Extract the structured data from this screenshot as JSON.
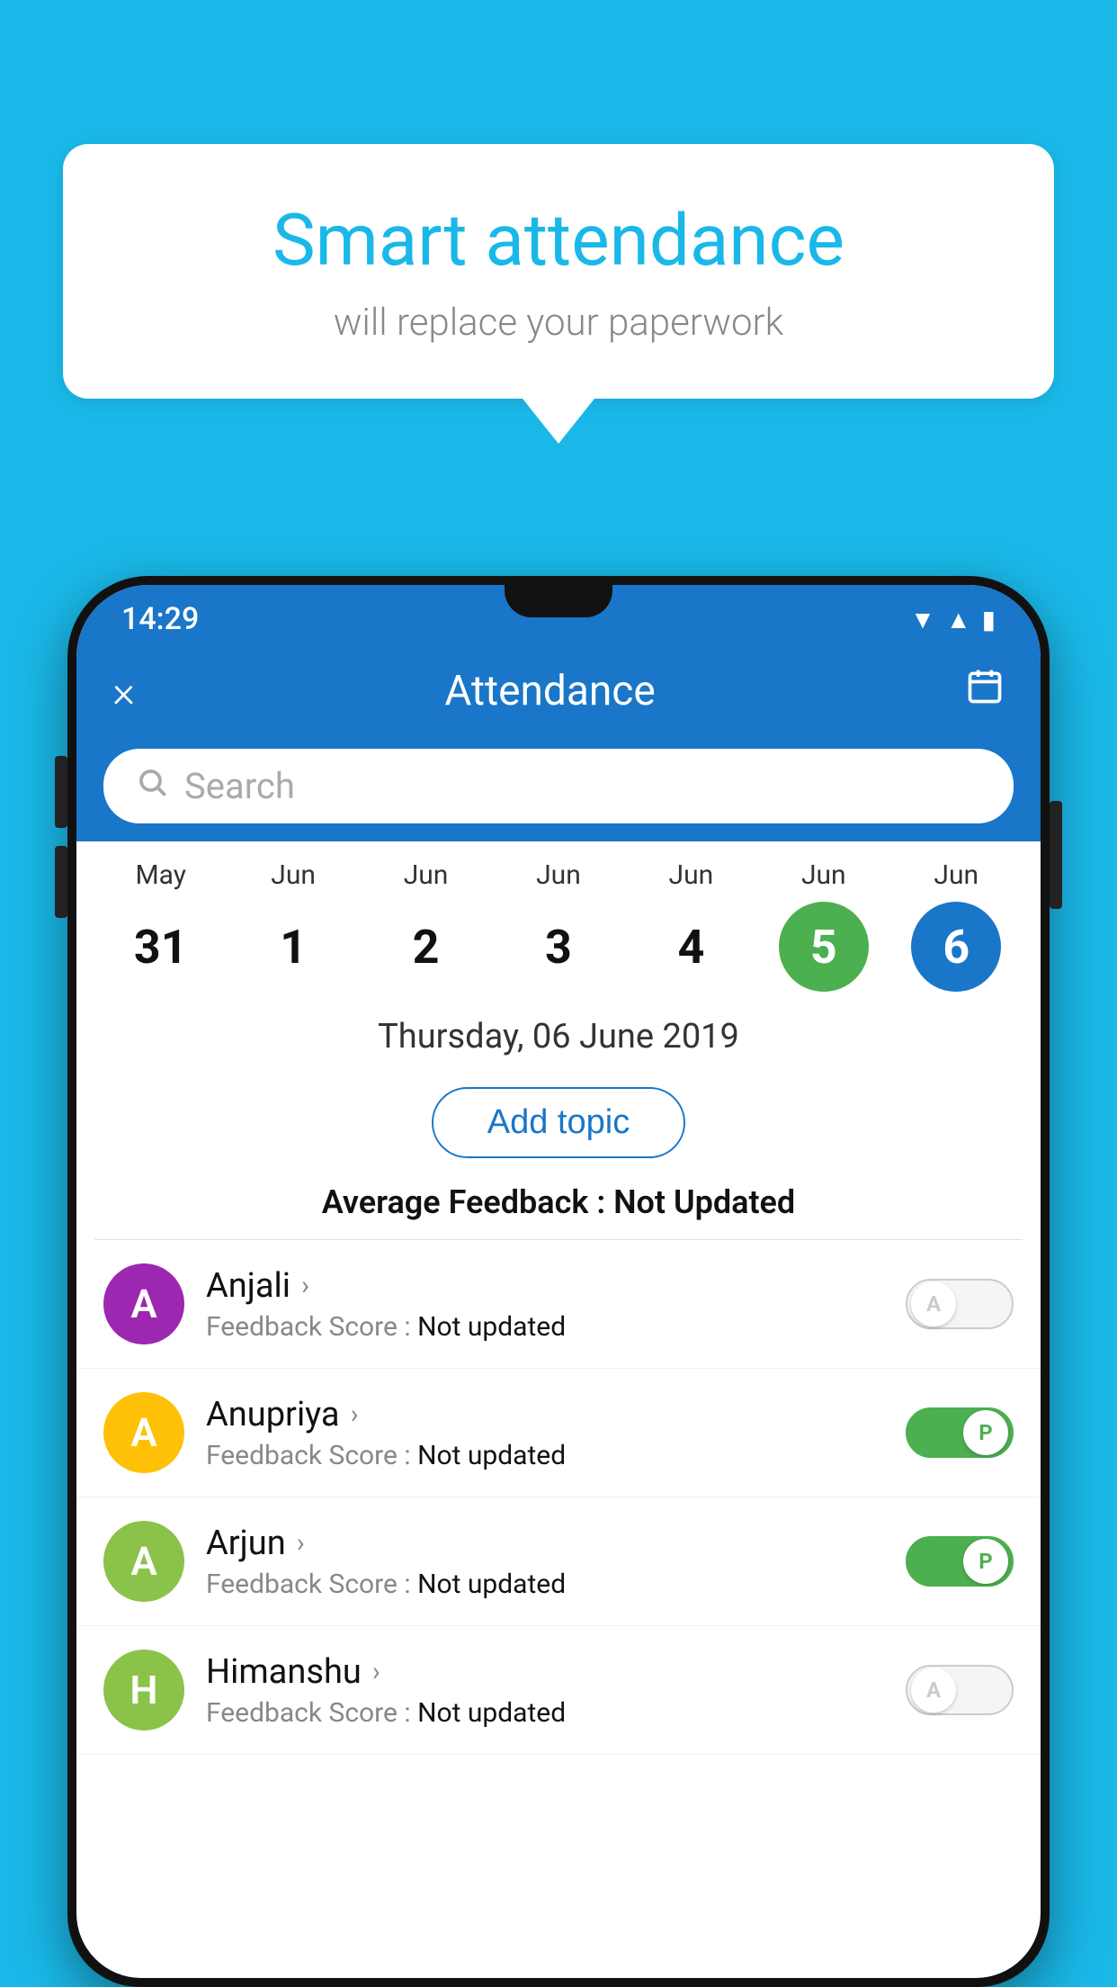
{
  "background_color": "#1ab8e8",
  "bubble": {
    "title": "Smart attendance",
    "subtitle": "will replace your paperwork"
  },
  "status_bar": {
    "time": "14:29"
  },
  "header": {
    "title": "Attendance",
    "close_label": "×",
    "calendar_icon": "calendar"
  },
  "search": {
    "placeholder": "Search"
  },
  "calendar": {
    "dates": [
      {
        "month": "May",
        "day": "31",
        "highlight": "none"
      },
      {
        "month": "Jun",
        "day": "1",
        "highlight": "none"
      },
      {
        "month": "Jun",
        "day": "2",
        "highlight": "none"
      },
      {
        "month": "Jun",
        "day": "3",
        "highlight": "none"
      },
      {
        "month": "Jun",
        "day": "4",
        "highlight": "none"
      },
      {
        "month": "Jun",
        "day": "5",
        "highlight": "green"
      },
      {
        "month": "Jun",
        "day": "6",
        "highlight": "blue"
      }
    ]
  },
  "selected_date": "Thursday, 06 June 2019",
  "add_topic_label": "Add topic",
  "avg_feedback_label": "Average Feedback :",
  "avg_feedback_value": "Not Updated",
  "students": [
    {
      "name": "Anjali",
      "avatar_letter": "A",
      "avatar_color": "purple",
      "feedback_label": "Feedback Score :",
      "feedback_value": "Not updated",
      "toggle_state": "off",
      "toggle_letter": "A"
    },
    {
      "name": "Anupriya",
      "avatar_letter": "A",
      "avatar_color": "yellow",
      "feedback_label": "Feedback Score :",
      "feedback_value": "Not updated",
      "toggle_state": "on",
      "toggle_letter": "P"
    },
    {
      "name": "Arjun",
      "avatar_letter": "A",
      "avatar_color": "green",
      "feedback_label": "Feedback Score :",
      "feedback_value": "Not updated",
      "toggle_state": "on",
      "toggle_letter": "P"
    },
    {
      "name": "Himanshu",
      "avatar_letter": "H",
      "avatar_color": "green2",
      "feedback_label": "Feedback Score :",
      "feedback_value": "Not updated",
      "toggle_state": "off",
      "toggle_letter": "A"
    }
  ]
}
